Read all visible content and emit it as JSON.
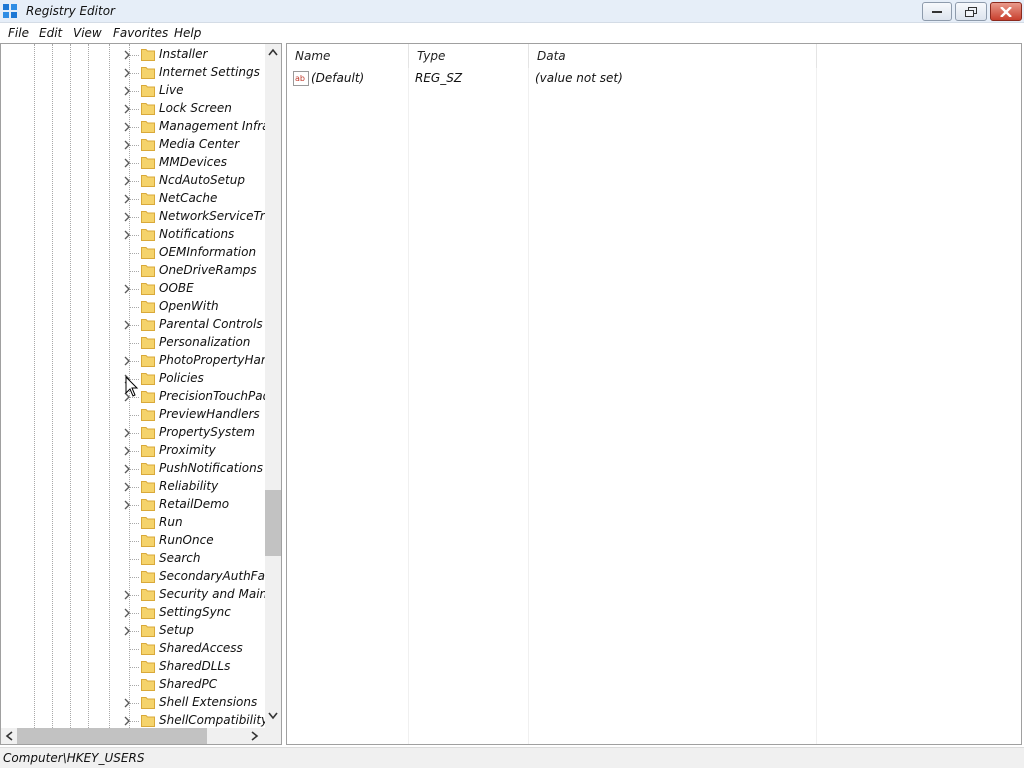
{
  "window": {
    "title": "Registry Editor",
    "icon": "registry-icon",
    "controls": [
      "minimize-icon",
      "restore-icon",
      "close-icon"
    ]
  },
  "menu": [
    "File",
    "Edit",
    "View",
    "Favorites",
    "Help"
  ],
  "tree": {
    "items": [
      {
        "label": "Installer",
        "expandable": true
      },
      {
        "label": "Internet Settings",
        "expandable": true
      },
      {
        "label": "Live",
        "expandable": true
      },
      {
        "label": "Lock Screen",
        "expandable": true
      },
      {
        "label": "Management Infras",
        "expandable": true
      },
      {
        "label": "Media Center",
        "expandable": true
      },
      {
        "label": "MMDevices",
        "expandable": true
      },
      {
        "label": "NcdAutoSetup",
        "expandable": true
      },
      {
        "label": "NetCache",
        "expandable": true
      },
      {
        "label": "NetworkServiceTrigg",
        "expandable": true
      },
      {
        "label": "Notifications",
        "expandable": true
      },
      {
        "label": "OEMInformation",
        "expandable": false
      },
      {
        "label": "OneDriveRamps",
        "expandable": false
      },
      {
        "label": "OOBE",
        "expandable": true
      },
      {
        "label": "OpenWith",
        "expandable": false
      },
      {
        "label": "Parental Controls",
        "expandable": true
      },
      {
        "label": "Personalization",
        "expandable": false
      },
      {
        "label": "PhotoPropertyHand",
        "expandable": true
      },
      {
        "label": "Policies",
        "expandable": true
      },
      {
        "label": "PrecisionTouchPad",
        "expandable": true
      },
      {
        "label": "PreviewHandlers",
        "expandable": false
      },
      {
        "label": "PropertySystem",
        "expandable": true
      },
      {
        "label": "Proximity",
        "expandable": true
      },
      {
        "label": "PushNotifications",
        "expandable": true
      },
      {
        "label": "Reliability",
        "expandable": true
      },
      {
        "label": "RetailDemo",
        "expandable": true
      },
      {
        "label": "Run",
        "expandable": false
      },
      {
        "label": "RunOnce",
        "expandable": false
      },
      {
        "label": "Search",
        "expandable": false
      },
      {
        "label": "SecondaryAuthFacto",
        "expandable": false
      },
      {
        "label": "Security and Mainte",
        "expandable": true
      },
      {
        "label": "SettingSync",
        "expandable": true
      },
      {
        "label": "Setup",
        "expandable": true
      },
      {
        "label": "SharedAccess",
        "expandable": false
      },
      {
        "label": "SharedDLLs",
        "expandable": false
      },
      {
        "label": "SharedPC",
        "expandable": false
      },
      {
        "label": "Shell Extensions",
        "expandable": true
      },
      {
        "label": "ShellCompatibility",
        "expandable": true
      }
    ]
  },
  "values": {
    "columns": {
      "name": "Name",
      "type": "Type",
      "data": "Data"
    },
    "rows": [
      {
        "name": "(Default)",
        "type": "REG_SZ",
        "data": "(value not set)",
        "icon": "string-value-icon"
      }
    ]
  },
  "status": {
    "path": "Computer\\HKEY_USERS"
  },
  "colors": {
    "folder": "#f5d36b",
    "title_bar": "#e6eef8",
    "close_button": "#c8402e"
  }
}
